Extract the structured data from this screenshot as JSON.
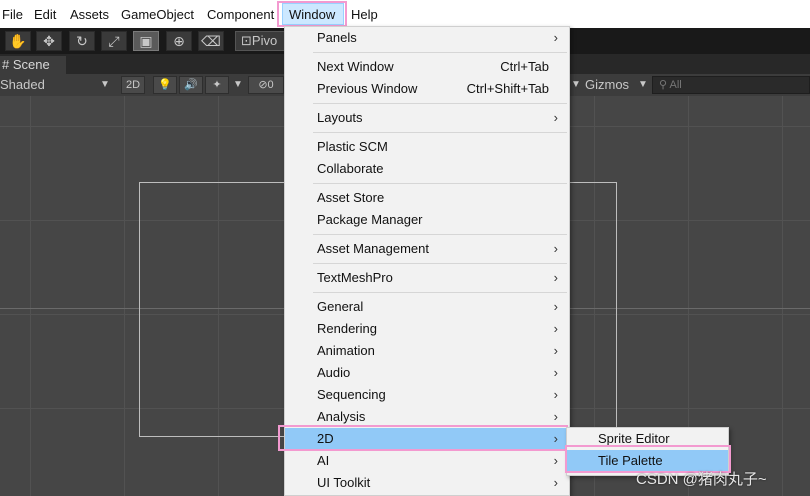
{
  "menubar": {
    "items": [
      "File",
      "Edit",
      "Assets",
      "GameObject",
      "Component",
      "Window",
      "Help"
    ]
  },
  "toolbar": {
    "tools": [
      "hand-tool",
      "move-tool",
      "rotate-tool",
      "scale-tool",
      "rect-tool",
      "transform-tool",
      "custom-tool"
    ],
    "pivot_label": "Pivo"
  },
  "scene": {
    "tab_label": "Scene",
    "shading_mode": "Shaded",
    "mode_2d": "2D",
    "hidden_count": "0",
    "gizmos_label": "Gizmos",
    "search_placeholder": "All"
  },
  "window_menu": {
    "items": [
      {
        "label": "Panels",
        "shortcut": "",
        "submenu": true
      },
      {
        "label": "Next Window",
        "shortcut": "Ctrl+Tab",
        "submenu": false
      },
      {
        "label": "Previous Window",
        "shortcut": "Ctrl+Shift+Tab",
        "submenu": false
      },
      {
        "label": "Layouts",
        "shortcut": "",
        "submenu": true
      },
      {
        "label": "Plastic SCM",
        "shortcut": "",
        "submenu": false
      },
      {
        "label": "Collaborate",
        "shortcut": "",
        "submenu": false
      },
      {
        "label": "Asset Store",
        "shortcut": "",
        "submenu": false
      },
      {
        "label": "Package Manager",
        "shortcut": "",
        "submenu": false
      },
      {
        "label": "Asset Management",
        "shortcut": "",
        "submenu": true
      },
      {
        "label": "TextMeshPro",
        "shortcut": "",
        "submenu": true
      },
      {
        "label": "General",
        "shortcut": "",
        "submenu": true
      },
      {
        "label": "Rendering",
        "shortcut": "",
        "submenu": true
      },
      {
        "label": "Animation",
        "shortcut": "",
        "submenu": true
      },
      {
        "label": "Audio",
        "shortcut": "",
        "submenu": true
      },
      {
        "label": "Sequencing",
        "shortcut": "",
        "submenu": true
      },
      {
        "label": "Analysis",
        "shortcut": "",
        "submenu": true
      },
      {
        "label": "2D",
        "shortcut": "",
        "submenu": true
      },
      {
        "label": "AI",
        "shortcut": "",
        "submenu": true
      },
      {
        "label": "UI Toolkit",
        "shortcut": "",
        "submenu": true
      }
    ]
  },
  "submenu_2d": {
    "items": [
      "Sprite Editor",
      "Tile Palette"
    ]
  },
  "watermark": "CSDN @猪肉丸子~",
  "colors": {
    "highlight": "#91c9f7",
    "annotation_outline": "#f39ad0",
    "menu_background": "#f2f2f2",
    "scene_background": "#464646"
  }
}
